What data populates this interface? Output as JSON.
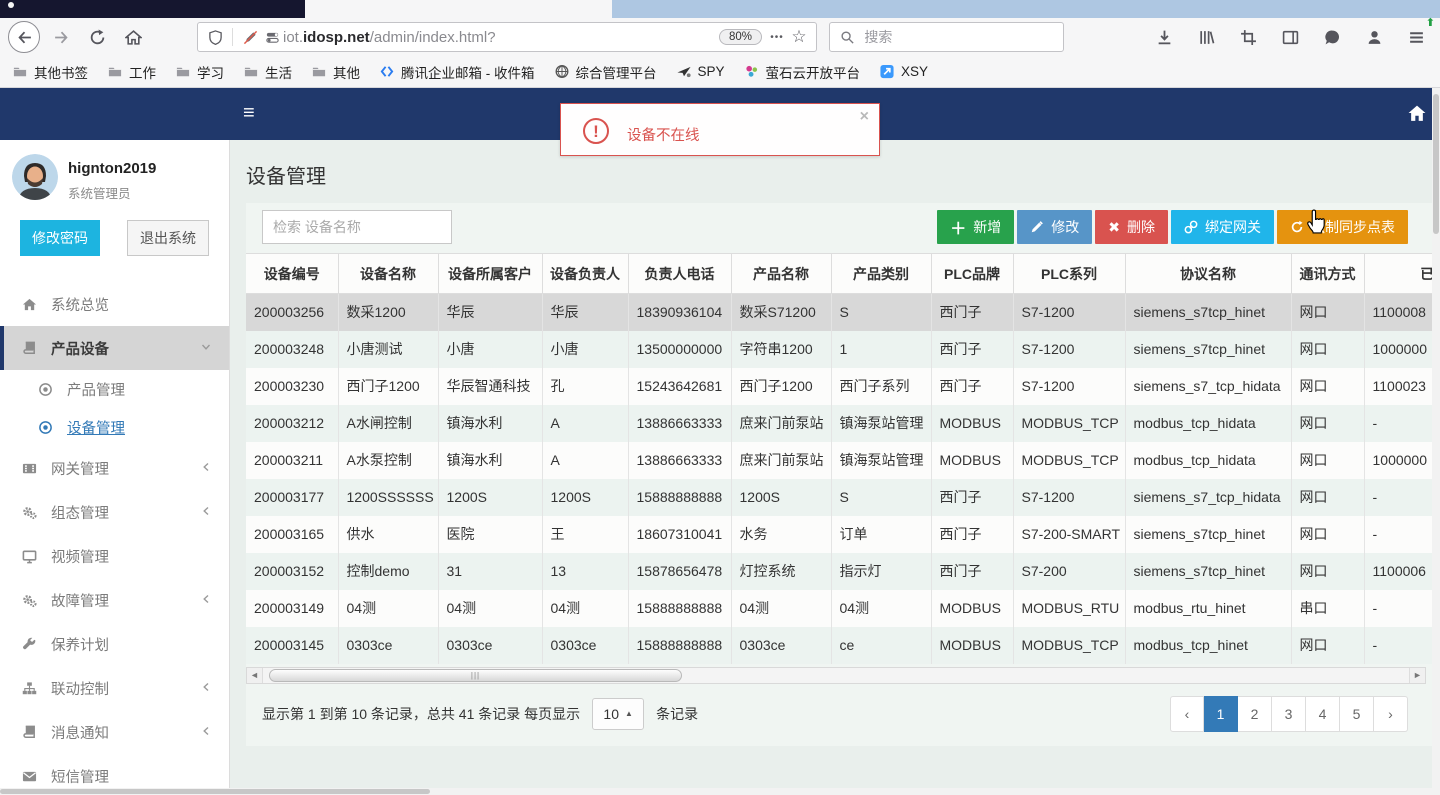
{
  "browser": {
    "toolbar": {
      "url_prefix": "iot.",
      "url_domain": "idosp.net",
      "url_path": "/admin/index.html?",
      "zoom_badge": "80%",
      "search_placeholder": "搜索",
      "dots_glyph": "•••",
      "star_glyph": "☆"
    },
    "bookmarks": [
      {
        "icon": "folder",
        "label": "其他书签"
      },
      {
        "icon": "folder",
        "label": "工作"
      },
      {
        "icon": "folder",
        "label": "学习"
      },
      {
        "icon": "folder",
        "label": "生活"
      },
      {
        "icon": "folder",
        "label": "其他"
      },
      {
        "icon": "tencent",
        "label": "腾讯企业邮箱 - 收件箱"
      },
      {
        "icon": "globe",
        "label": "综合管理平台"
      },
      {
        "icon": "spy",
        "label": "SPY"
      },
      {
        "icon": "ys",
        "label": "萤石云开放平台"
      },
      {
        "icon": "xsy",
        "label": "XSY"
      }
    ]
  },
  "topnav": {
    "hamburger_glyph": "≡"
  },
  "alert": {
    "text": "设备不在线",
    "close_glyph": "×",
    "icon_glyph": "!"
  },
  "sidebar": {
    "username": "hignton2019",
    "role": "系统管理员",
    "change_password_label": "修改密码",
    "logout_label": "退出系统",
    "items": [
      {
        "icon": "home",
        "label": "系统总览"
      },
      {
        "icon": "book",
        "label": "产品设备",
        "chevron": "down",
        "active": true,
        "children": [
          {
            "icon": "dot-circle",
            "label": "产品管理",
            "active": false
          },
          {
            "icon": "dot-circle",
            "label": "设备管理",
            "active": true
          }
        ]
      },
      {
        "icon": "film",
        "label": "网关管理",
        "chevron": "left"
      },
      {
        "icon": "gears",
        "label": "组态管理",
        "chevron": "left"
      },
      {
        "icon": "monitor",
        "label": "视频管理"
      },
      {
        "icon": "gears",
        "label": "故障管理",
        "chevron": "left"
      },
      {
        "icon": "wrench",
        "label": "保养计划"
      },
      {
        "icon": "sitemap",
        "label": "联动控制",
        "chevron": "left"
      },
      {
        "icon": "book",
        "label": "消息通知",
        "chevron": "left"
      },
      {
        "icon": "envelope",
        "label": "短信管理"
      }
    ]
  },
  "main": {
    "title": "设备管理",
    "search_placeholder": "检索 设备名称",
    "action_buttons": [
      {
        "name": "add",
        "icon": "plus",
        "label": "新增",
        "color": "#28a24c"
      },
      {
        "name": "edit",
        "icon": "pencil",
        "label": "修改",
        "color": "#5795c8"
      },
      {
        "name": "delete",
        "icon": "cross",
        "label": "删除",
        "color": "#d9534f"
      },
      {
        "name": "bind-gateway",
        "icon": "link",
        "label": "绑定网关",
        "color": "#20b5ea"
      },
      {
        "name": "force-sync",
        "icon": "refresh",
        "label": "强制同步点表",
        "color": "#e5930f"
      }
    ],
    "table": {
      "headers": [
        "设备编号",
        "设备名称",
        "设备所属客户",
        "设备负责人",
        "负责人电话",
        "产品名称",
        "产品类别",
        "PLC品牌",
        "PLC系列",
        "协议名称",
        "通讯方式",
        "已绑定网关"
      ],
      "selected_row_index": 0,
      "rows": [
        [
          "200003256",
          "数采1200",
          "华辰",
          "华辰",
          "18390936104",
          "数采S71200",
          "S",
          "西门子",
          "S7-1200",
          "siemens_s7tcp_hinet",
          "网口",
          "1100008"
        ],
        [
          "200003248",
          "小唐测试",
          "小唐",
          "小唐",
          "13500000000",
          "字符串1200",
          "1",
          "西门子",
          "S7-1200",
          "siemens_s7tcp_hinet",
          "网口",
          "1000000"
        ],
        [
          "200003230",
          "西门子1200",
          "华辰智通科技",
          "孔",
          "15243642681",
          "西门子1200",
          "西门子系列",
          "西门子",
          "S7-1200",
          "siemens_s7_tcp_hidata",
          "网口",
          "1100023"
        ],
        [
          "200003212",
          "A水闸控制",
          "镇海水利",
          "A",
          "13886663333",
          "庶来门前泵站",
          "镇海泵站管理",
          "MODBUS",
          "MODBUS_TCP",
          "modbus_tcp_hidata",
          "网口",
          "-"
        ],
        [
          "200003211",
          "A水泵控制",
          "镇海水利",
          "A",
          "13886663333",
          "庶来门前泵站",
          "镇海泵站管理",
          "MODBUS",
          "MODBUS_TCP",
          "modbus_tcp_hidata",
          "网口",
          "1000000"
        ],
        [
          "200003177",
          "1200SSSSSS",
          "1200S",
          "1200S",
          "15888888888",
          "1200S",
          "S",
          "西门子",
          "S7-1200",
          "siemens_s7_tcp_hidata",
          "网口",
          "-"
        ],
        [
          "200003165",
          "供水",
          "医院",
          "王",
          "18607310041",
          "水务",
          "订单",
          "西门子",
          "S7-200-SMART",
          "siemens_s7tcp_hinet",
          "网口",
          "-"
        ],
        [
          "200003152",
          "控制demo",
          "31",
          "13",
          "15878656478",
          "灯控系统",
          "指示灯",
          "西门子",
          "S7-200",
          "siemens_s7tcp_hinet",
          "网口",
          "1100006"
        ],
        [
          "200003149",
          "04测",
          "04测",
          "04测",
          "15888888888",
          "04测",
          "04测",
          "MODBUS",
          "MODBUS_RTU",
          "modbus_rtu_hinet",
          "串口",
          "-"
        ],
        [
          "200003145",
          "0303ce",
          "0303ce",
          "0303ce",
          "15888888888",
          "0303ce",
          "ce",
          "MODBUS",
          "MODBUS_TCP",
          "modbus_tcp_hinet",
          "网口",
          "-"
        ]
      ]
    },
    "pagination": {
      "summary_prefix": "显示第 1 到第 10 条记录，总共 41 条记录 每页显示",
      "page_size": "10",
      "summary_suffix": "条记录",
      "pages": [
        "1",
        "2",
        "3",
        "4",
        "5"
      ],
      "active_page": "1",
      "prev_glyph": "‹",
      "next_glyph": "›"
    }
  },
  "colors": {
    "navbar": "#20386b",
    "active_page": "#337ab7",
    "alert_red": "#d9534f",
    "change_password_btn": "#1db4e0"
  }
}
